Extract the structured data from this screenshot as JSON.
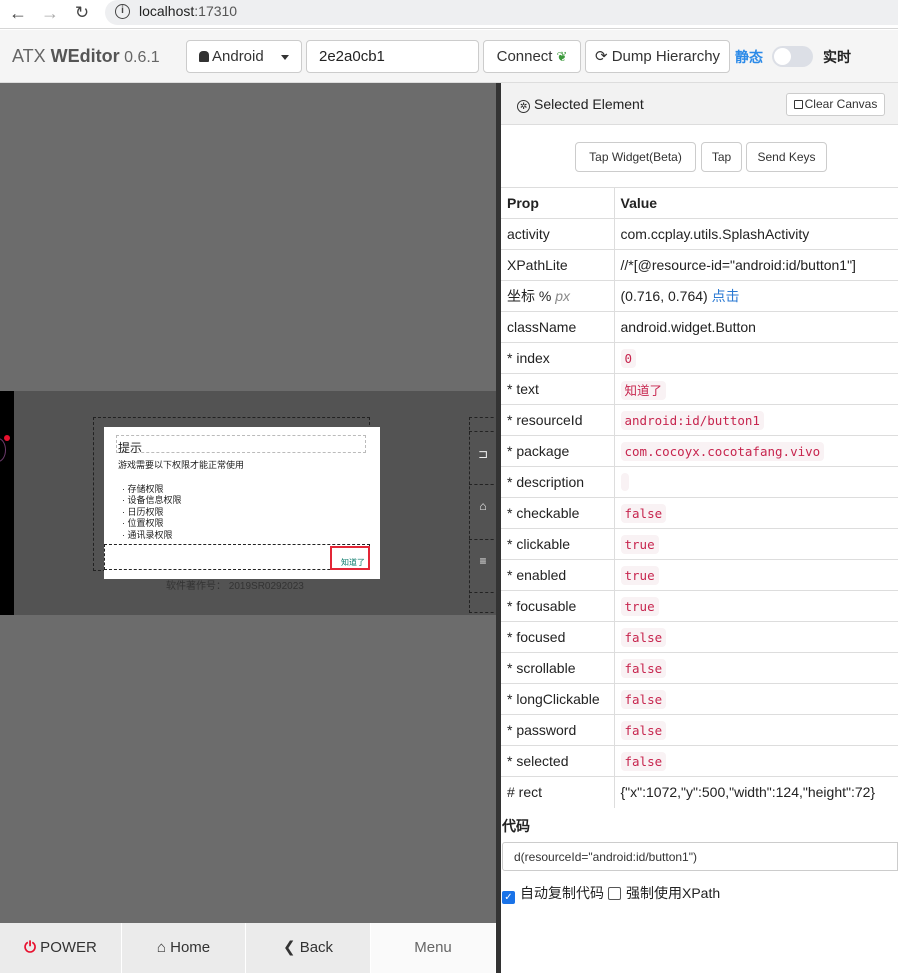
{
  "browser": {
    "url_host": "localhost",
    "url_port": ":17310",
    "back_icon": "←",
    "forward_icon": "→",
    "reload_icon": "↻",
    "info_icon": "i"
  },
  "header": {
    "brand_light": "ATX ",
    "brand_bold": "WEditor",
    "version": " 0.6.1",
    "platform_selected": "Android",
    "serial_value": "2e2a0cb1",
    "connect_label": "Connect",
    "connect_icon": "❦",
    "dump_icon": "⟳",
    "dump_label": "Dump Hierarchy",
    "mode_static": "静态",
    "mode_live": "实时",
    "live_enabled": false
  },
  "device": {
    "dialog": {
      "title": "提示",
      "message": "游戏需要以下权限才能正常使用",
      "permissions": [
        "存储权限",
        "设备信息权限",
        "日历权限",
        "位置权限",
        "通讯录权限"
      ],
      "button": "知道了"
    },
    "below_text": "软件著作号：  2019SR0292023",
    "nav_icons": [
      "⊐",
      "⌂",
      "≡"
    ]
  },
  "bottom_bar": {
    "power_icon": "⏻",
    "power_label": " POWER",
    "home_icon": "⌂",
    "home_label": " Home",
    "back_icon": "❮",
    "back_label": " Back",
    "menu_label": "Menu"
  },
  "inspector": {
    "title": "Selected Element",
    "title_icon": "✲",
    "clear_canvas": "Clear Canvas",
    "actions": [
      "Tap Widget(Beta)",
      "Tap",
      "Send Keys"
    ],
    "columns": [
      "Prop",
      "Value"
    ],
    "activity": {
      "prop": "activity",
      "value": "com.ccplay.utils.SplashActivity"
    },
    "xpath": {
      "prop": "XPathLite",
      "value": "//*[@resource-id=\"android:id/button1\"]"
    },
    "coord": {
      "prop": "坐标 % ",
      "unit": "px",
      "value": "(0.716, 0.764) ",
      "link": "点击"
    },
    "classname": {
      "prop": "className",
      "value": "android.widget.Button"
    },
    "attrs": [
      {
        "prop": "* index",
        "value": "0"
      },
      {
        "prop": "* text",
        "value": "知道了"
      },
      {
        "prop": "* resourceId",
        "value": "android:id/button1"
      },
      {
        "prop": "* package",
        "value": "com.cocoyx.cocotafang.vivo"
      },
      {
        "prop": "* description",
        "value": ""
      },
      {
        "prop": "* checkable",
        "value": "false"
      },
      {
        "prop": "* clickable",
        "value": "true"
      },
      {
        "prop": "* enabled",
        "value": "true"
      },
      {
        "prop": "* focusable",
        "value": "true"
      },
      {
        "prop": "* focused",
        "value": "false"
      },
      {
        "prop": "* scrollable",
        "value": "false"
      },
      {
        "prop": "* longClickable",
        "value": "false"
      },
      {
        "prop": "* password",
        "value": "false"
      },
      {
        "prop": "* selected",
        "value": "false"
      }
    ],
    "rect": {
      "prop": "# rect",
      "value": "{\"x\":1072,\"y\":500,\"width\":124,\"height\":72}"
    },
    "code_label": "代码",
    "code_value": "d(resourceId=\"android:id/button1\")",
    "auto_copy_label": "自动复制代码",
    "auto_copy_checked": true,
    "force_xpath_label": "强制使用XPath",
    "force_xpath_checked": false
  },
  "colors": {
    "accent": "#2b8ae8",
    "power_red": "#e8102e",
    "code_red": "#c7254e",
    "selection_border": "#e32636"
  }
}
